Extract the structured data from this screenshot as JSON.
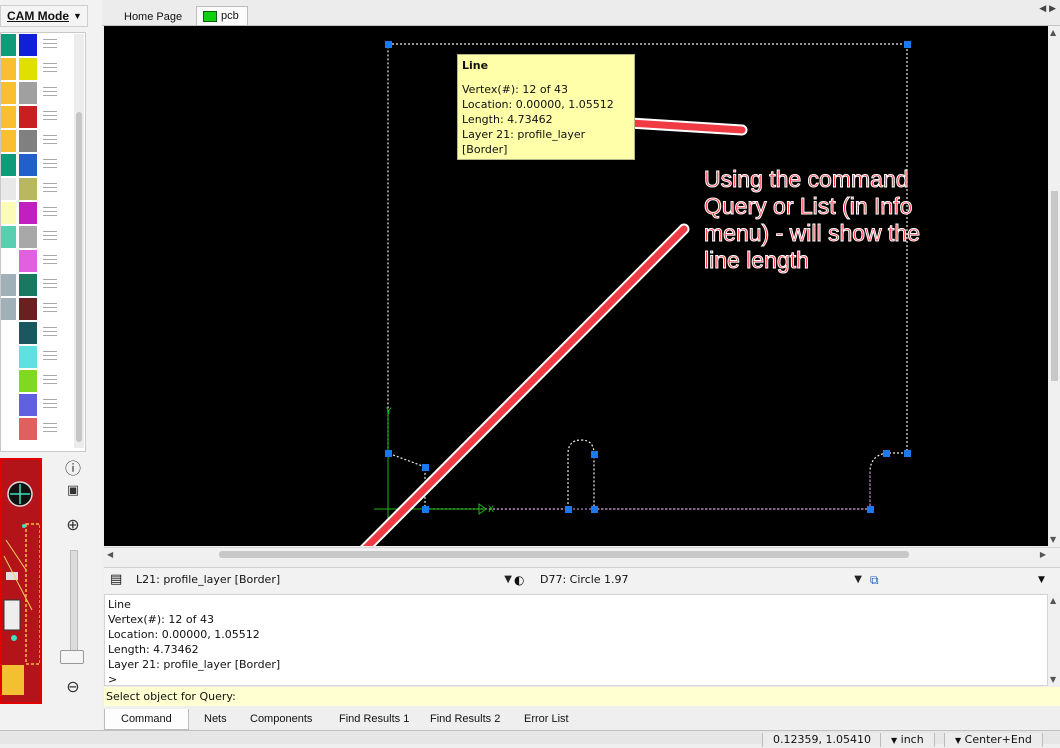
{
  "left_panel": {
    "mode_title": "CAM Mode",
    "layers": [
      {
        "c1": "#0f9a7a",
        "c2": "#1020d8"
      },
      {
        "c1": "#f8c030",
        "c2": "#e0e000"
      },
      {
        "c1": "#f8c030",
        "c2": "#a0a0a0"
      },
      {
        "c1": "#f8c030",
        "c2": "#c82020"
      },
      {
        "c1": "#f8c030",
        "c2": "#808080"
      },
      {
        "c1": "#0f9a7a",
        "c2": "#2060c8"
      },
      {
        "c1": "#e8e8e8",
        "c2": "#b8b860"
      },
      {
        "c1": "#fcfcb8",
        "c2": "#c020c0"
      },
      {
        "c1": "#5acfb0",
        "c2": "#a8a8a8"
      },
      {
        "c1": "#ffffff",
        "c2": "#e060e0"
      },
      {
        "c1": "#a0b0b8",
        "c2": "#1a7860"
      },
      {
        "c1": "#a0b0b8",
        "c2": "#6a2020"
      },
      {
        "c1": "#ffffff",
        "c2": "#1a5860"
      },
      {
        "c1": "#ffffff",
        "c2": "#60e0e0"
      },
      {
        "c1": "#ffffff",
        "c2": "#80d820"
      },
      {
        "c1": "#ffffff",
        "c2": "#6060e0"
      },
      {
        "c1": "#ffffff",
        "c2": "#e06060"
      }
    ]
  },
  "tabs": {
    "home": "Home Page",
    "pcb": "pcb"
  },
  "tooltip": {
    "title": "Line",
    "vertex": "Vertex(#): 12 of 43",
    "location": "Location: 0.00000, 1.05512",
    "length": "Length: 4.73462",
    "layer": "Layer 21: profile_layer  [Border]"
  },
  "annotation": {
    "text": "Using the command Query or List (in Info menu) - will show the line length",
    "color": "#ff2b3a"
  },
  "toolbar": {
    "layer_value": "L21: profile_layer  [Border]",
    "dcode_value": "D77: Circle 1.97"
  },
  "output": {
    "lines": [
      "Line",
      "Vertex(#): 12 of 43",
      "Location: 0.00000, 1.05512",
      "Length: 4.73462",
      "Layer 21: profile_layer  [Border]",
      ">"
    ]
  },
  "status_line": "Select object for Query:",
  "bottom_tabs": [
    "Command",
    "Nets",
    "Components",
    "Find Results 1",
    "Find Results 2",
    "Error List"
  ],
  "statusbar": {
    "coords": "0.12359, 1.05410",
    "units": "inch",
    "zoom_mode": "Center+End"
  }
}
